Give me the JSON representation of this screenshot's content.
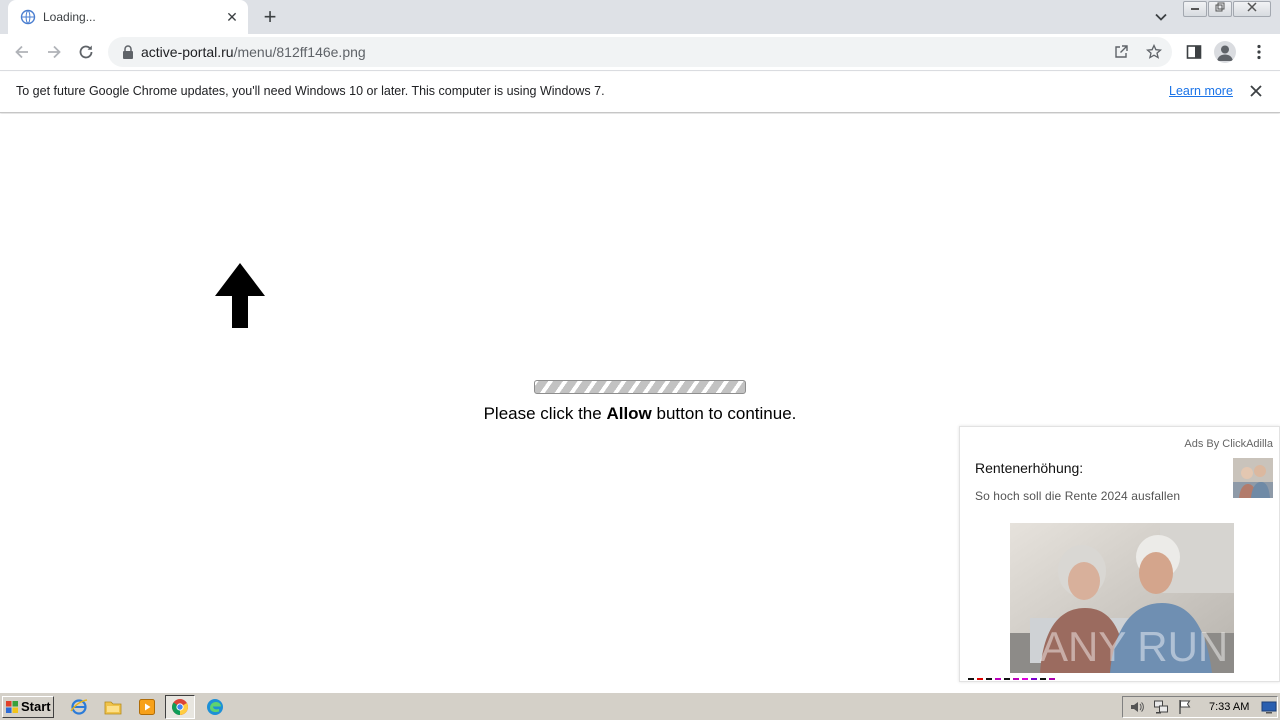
{
  "browser": {
    "tab": {
      "title": "Loading...",
      "close_label": "✕"
    },
    "new_tab_label": "+",
    "omnibox": {
      "host": "active-portal.ru",
      "path": "/menu/812ff146e.png"
    }
  },
  "infobar": {
    "message": "To get future Google Chrome updates, you'll need Windows 10 or later. This computer is using Windows 7.",
    "link": "Learn more"
  },
  "page": {
    "cta_prefix": "Please click the ",
    "cta_bold": "Allow",
    "cta_suffix": " button to continue."
  },
  "ad": {
    "provider": "Ads By ClickAdilla",
    "title": "Rentenerhöhung:",
    "description": "So hoch soll die Rente 2024 ausfallen",
    "watermark": "ANY RUN"
  },
  "taskbar": {
    "start_label": "Start",
    "clock": "7:33 AM"
  },
  "colors": {
    "link": "#1a73e8",
    "tabstrip": "#dee1e6",
    "taskbar": "#d4d0c8"
  }
}
